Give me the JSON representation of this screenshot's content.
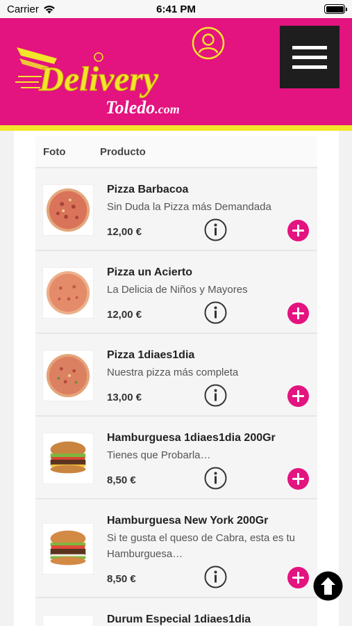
{
  "status": {
    "carrier": "Carrier",
    "time": "6:41 PM"
  },
  "header": {
    "logo_text_main": "Delivery",
    "logo_text_sub": "Toledo",
    "logo_text_tld": ".com",
    "brand_color": "#e3137f",
    "accent_color": "#f3e52a"
  },
  "table": {
    "col_foto": "Foto",
    "col_producto": "Producto",
    "products": [
      {
        "name": "Pizza Barbacoa",
        "description": "Sin Duda la Pizza más Demandada",
        "price": "12,00 €",
        "image": "pizza-image"
      },
      {
        "name": "Pizza un Acierto",
        "description": "La Delicia de Niños y Mayores",
        "price": "12,00 €",
        "image": "pizza-image"
      },
      {
        "name": "Pizza 1diaes1dia",
        "description": "Nuestra pizza más completa",
        "price": "13,00 €",
        "image": "pizza-image"
      },
      {
        "name": "Hamburguesa 1diaes1dia 200Gr",
        "description": "Tienes que Probarla…",
        "price": "8,50 €",
        "image": "burger-image"
      },
      {
        "name": "Hamburguesa New York 200Gr",
        "description": "Si te gusta el queso de Cabra, esta es tu Hamburguesa…",
        "price": "8,50 €",
        "image": "burger-image"
      },
      {
        "name": "Durum Especial 1diaes1dia",
        "description": "",
        "price": "",
        "image": "durum-image"
      }
    ]
  },
  "icons": {
    "info": "info-circle-icon",
    "add": "plus-circle-icon",
    "scroll_top": "arrow-up-circle-icon",
    "user": "user-circle-icon",
    "menu": "hamburger-menu-icon"
  }
}
